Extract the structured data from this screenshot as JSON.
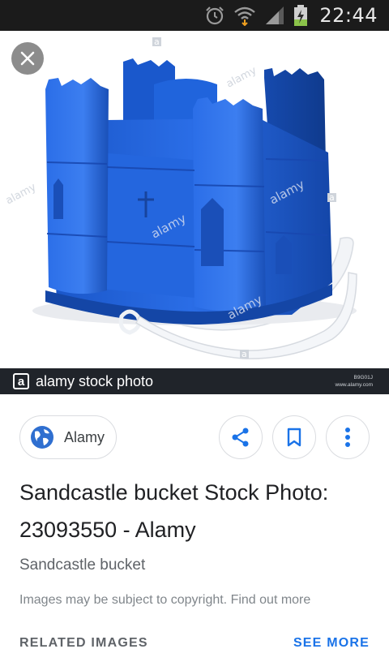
{
  "status_bar": {
    "time": "22:44",
    "icons": [
      "alarm-icon",
      "wifi-icon",
      "signal-icon",
      "battery-charging-icon"
    ]
  },
  "viewer": {
    "close_icon": "close-icon",
    "watermark": "alamy",
    "watermark_small": "a",
    "image_subject": "blue sandcastle bucket"
  },
  "credit": {
    "logo": "a",
    "text": "alamy stock photo",
    "code": "B9G01J",
    "site": "www.alamy.com"
  },
  "source": {
    "icon": "globe-icon",
    "name": "Alamy"
  },
  "actions": {
    "share_icon": "share-icon",
    "save_icon": "bookmark-icon",
    "more_icon": "more-vert-icon"
  },
  "result": {
    "title": "Sandcastle bucket Stock Photo: 23093550 - Alamy",
    "subtitle": "Sandcastle bucket",
    "copyright": "Images may be subject to copyright. Find out more"
  },
  "related": {
    "heading": "RELATED IMAGES",
    "see_more": "SEE MORE"
  },
  "colors": {
    "status_bar": "#1b1b1b",
    "credit_bar": "#20242a",
    "bucket_blue": "#1f5fd6",
    "accent_blue": "#1a73e8",
    "globe_blue": "#2f6fd0"
  }
}
